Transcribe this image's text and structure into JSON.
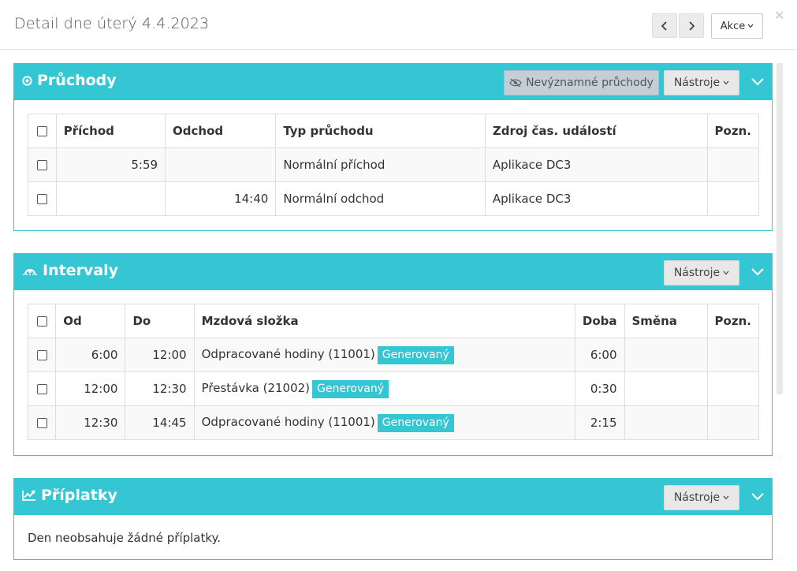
{
  "modal": {
    "title": "Detail dne úterý 4.4.2023",
    "prev_icon": "chevron-left-icon",
    "next_icon": "chevron-right-icon",
    "akce_label": "Akce",
    "close_icon": "close-icon"
  },
  "colors": {
    "accent": "#35c6d3",
    "insignificant_button": "#c3ced6",
    "tools_button": "#e8e8e8"
  },
  "pruchody": {
    "title": "Průchody",
    "icon": "target-icon",
    "insignificant_label": "Nevýznamné průchody",
    "insignificant_icon": "eye-slash-icon",
    "tools_label": "Nástroje",
    "columns": [
      "Příchod",
      "Odchod",
      "Typ průchodu",
      "Zdroj čas. událostí",
      "Pozn."
    ],
    "rows": [
      {
        "prichod": "5:59",
        "odchod": "",
        "typ": "Normální příchod",
        "zdroj": "Aplikace DC3",
        "pozn": ""
      },
      {
        "prichod": "",
        "odchod": "14:40",
        "typ": "Normální odchod",
        "zdroj": "Aplikace DC3",
        "pozn": ""
      }
    ]
  },
  "intervaly": {
    "title": "Intervaly",
    "icon": "intervals-icon",
    "tools_label": "Nástroje",
    "columns": [
      "Od",
      "Do",
      "Mzdová složka",
      "Doba",
      "Směna",
      "Pozn."
    ],
    "rows": [
      {
        "od": "6:00",
        "do": "12:00",
        "slozka": "Odpracované hodiny (11001)",
        "badge": "Generovaný",
        "doba": "6:00",
        "smena": "",
        "pozn": ""
      },
      {
        "od": "12:00",
        "do": "12:30",
        "slozka": "Přestávka (21002)",
        "badge": "Generovaný",
        "doba": "0:30",
        "smena": "",
        "pozn": ""
      },
      {
        "od": "12:30",
        "do": "14:45",
        "slozka": "Odpracované hodiny (11001)",
        "badge": "Generovaný",
        "doba": "2:15",
        "smena": "",
        "pozn": ""
      }
    ]
  },
  "priplatky": {
    "title": "Příplatky",
    "icon": "line-chart-icon",
    "tools_label": "Nástroje",
    "empty_text": "Den neobsahuje žádné příplatky."
  }
}
